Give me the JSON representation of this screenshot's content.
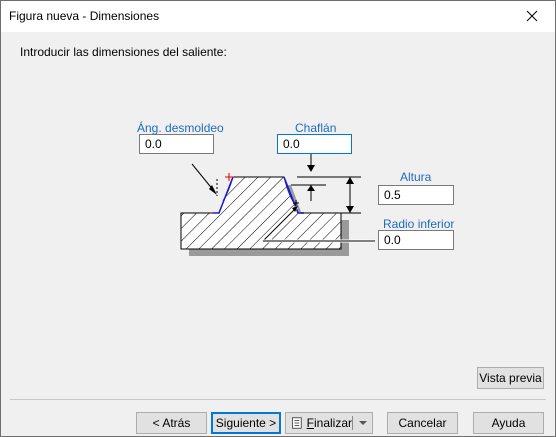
{
  "window": {
    "title": "Figura nueva - Dimensiones"
  },
  "instruction": "Introducir las dimensiones del saliente:",
  "fields": {
    "draft_angle": {
      "label": "Áng. desmoldeo",
      "value": "0.0"
    },
    "chamfer": {
      "label": "Chaflán",
      "value": "0.0"
    },
    "height": {
      "label": "Altura",
      "value": "0.5"
    },
    "bottom_radius": {
      "label": "Radio inferior",
      "value": "0.0"
    }
  },
  "buttons": {
    "preview": "Vista previa",
    "back": "< Atrás",
    "next": "Siguiente >",
    "finish_prefix": "F",
    "finish_rest": "inalizar",
    "cancel": "Cancelar",
    "help": "Ayuda"
  },
  "icons": {
    "close": "close-icon",
    "finish": "document-list-icon",
    "dropdown": "chevron-down-icon"
  }
}
